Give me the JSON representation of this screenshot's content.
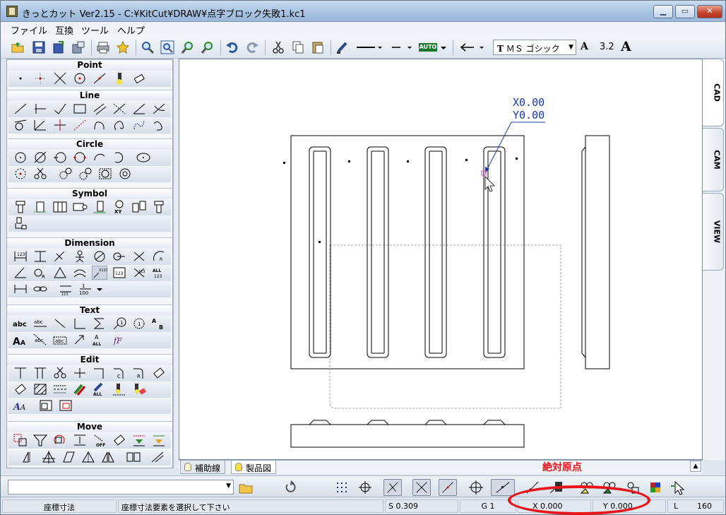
{
  "window": {
    "title": "きっとカット Ver2.15 - C:¥KitCut¥DRAW¥点字ブロック失敗1.kc1",
    "min_label": "▁",
    "max_label": "▭",
    "close_label": "✕"
  },
  "menu": {
    "items": [
      "ファイル",
      "互換",
      "ツール",
      "ヘルプ"
    ]
  },
  "toolbar": {
    "font_name": "ＭＳ ゴシック",
    "font_size": "3.2",
    "font_icon_label": "A",
    "font_size_icon_label": "A",
    "auto_label": "AUTO",
    "tt_label": "T",
    "font_arrow": "▼"
  },
  "palette": {
    "sections": [
      "Point",
      "Line",
      "Circle",
      "Symbol",
      "Dimension",
      "Text",
      "Edit",
      "Move"
    ]
  },
  "canvas": {
    "coord_x": "X0.00",
    "coord_y": "Y0.00"
  },
  "right_tabs": [
    "CAD",
    "CAM",
    "VIEW"
  ],
  "bottom_tabs": [
    "補助線",
    "製品図"
  ],
  "annotation": "絶対原点",
  "status": {
    "mode": "座標寸法",
    "message": "座標寸法要素を選択して下さい",
    "scale": "S 0.309",
    "grid": "G 1",
    "x": "X 0.000",
    "y": "Y 0.000",
    "layer_label": "L",
    "layer_value": "160"
  },
  "colors": {
    "annotation": "#e8141a",
    "coord_text": "#1a3aa8",
    "drawing_line": "#000000"
  }
}
